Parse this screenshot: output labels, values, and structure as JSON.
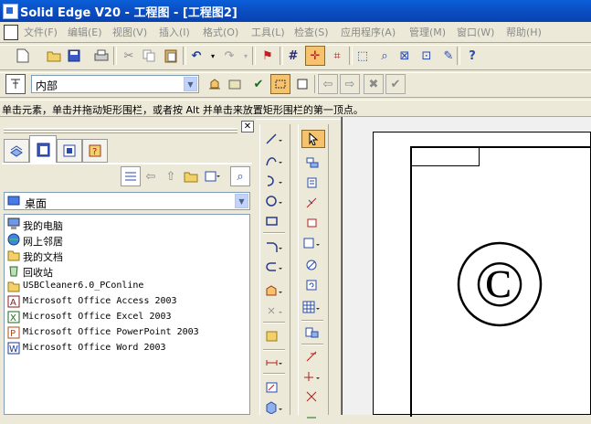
{
  "window": {
    "title": "Solid Edge V20 - 工程图 - [工程图2]"
  },
  "menu": [
    "文件(F)",
    "编辑(E)",
    "视图(V)",
    "插入(I)",
    "格式(O)",
    "工具(L)",
    "检查(S)",
    "应用程序(A)",
    "管理(M)",
    "窗口(W)",
    "帮助(H)"
  ],
  "layer_combo": {
    "value": "内部"
  },
  "status": {
    "prompt": "单击元素，单击并拖动矩形围栏，或者按 Alt 并单击来放置矩形围栏的第一顶点。"
  },
  "library": {
    "location_value": "桌面",
    "items": [
      {
        "label": "我的电脑",
        "icon": "computer-icon"
      },
      {
        "label": "网上邻居",
        "icon": "network-icon"
      },
      {
        "label": "我的文档",
        "icon": "documents-icon"
      },
      {
        "label": "回收站",
        "icon": "recycle-bin-icon"
      },
      {
        "label": "USBCleaner6.0_PConline",
        "icon": "folder-icon"
      },
      {
        "label": "Microsoft Office Access 2003",
        "icon": "access-icon"
      },
      {
        "label": "Microsoft Office Excel 2003",
        "icon": "excel-icon"
      },
      {
        "label": "Microsoft Office PowerPoint 2003",
        "icon": "powerpoint-icon"
      },
      {
        "label": "Microsoft Office Word 2003",
        "icon": "word-icon"
      }
    ]
  },
  "drawing": {
    "symbol": "©"
  },
  "colors": {
    "title_bar": "#0b4fc4",
    "accent_select": "#f6c26b",
    "window_bg": "#ece9d8"
  }
}
